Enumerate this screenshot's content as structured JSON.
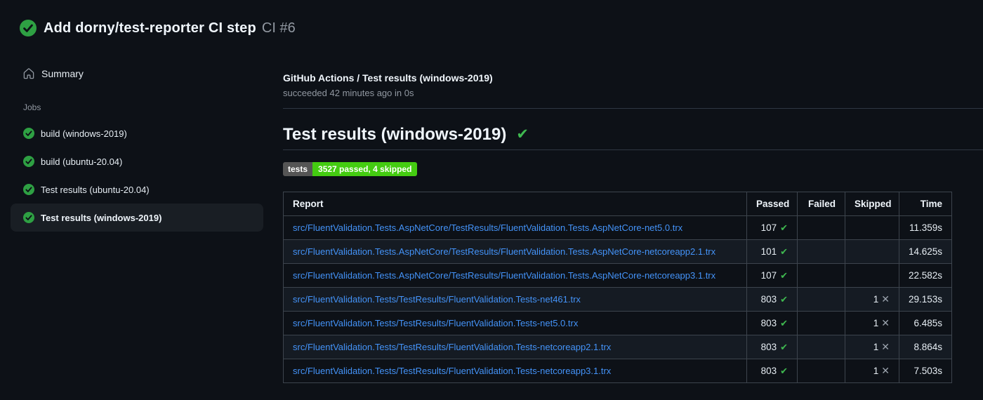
{
  "header": {
    "run_title": "Add dorny/test-reporter CI step",
    "run_number": "CI #6"
  },
  "sidebar": {
    "summary_label": "Summary",
    "jobs_label": "Jobs",
    "jobs": [
      {
        "label": "build (windows-2019)",
        "selected": false
      },
      {
        "label": "build (ubuntu-20.04)",
        "selected": false
      },
      {
        "label": "Test results (ubuntu-20.04)",
        "selected": false
      },
      {
        "label": "Test results (windows-2019)",
        "selected": true
      }
    ]
  },
  "main": {
    "check_title": "GitHub Actions / Test results (windows-2019)",
    "check_status": "succeeded 42 minutes ago in 0s",
    "section_title": "Test results (windows-2019)",
    "section_check_icon": "✔",
    "badge": {
      "label": "tests",
      "value": "3527 passed, 4 skipped",
      "label_bg": "#555555",
      "value_bg": "#44cc11"
    },
    "table": {
      "columns": [
        "Report",
        "Passed",
        "Failed",
        "Skipped",
        "Time"
      ],
      "rows": [
        {
          "report": "src/FluentValidation.Tests.AspNetCore/TestResults/FluentValidation.Tests.AspNetCore-net5.0.trx",
          "passed": "107",
          "failed": "",
          "skipped": "",
          "time": "11.359s"
        },
        {
          "report": "src/FluentValidation.Tests.AspNetCore/TestResults/FluentValidation.Tests.AspNetCore-netcoreapp2.1.trx",
          "passed": "101",
          "failed": "",
          "skipped": "",
          "time": "14.625s"
        },
        {
          "report": "src/FluentValidation.Tests.AspNetCore/TestResults/FluentValidation.Tests.AspNetCore-netcoreapp3.1.trx",
          "passed": "107",
          "failed": "",
          "skipped": "",
          "time": "22.582s"
        },
        {
          "report": "src/FluentValidation.Tests/TestResults/FluentValidation.Tests-net461.trx",
          "passed": "803",
          "failed": "",
          "skipped": "1",
          "time": "29.153s"
        },
        {
          "report": "src/FluentValidation.Tests/TestResults/FluentValidation.Tests-net5.0.trx",
          "passed": "803",
          "failed": "",
          "skipped": "1",
          "time": "6.485s"
        },
        {
          "report": "src/FluentValidation.Tests/TestResults/FluentValidation.Tests-netcoreapp2.1.trx",
          "passed": "803",
          "failed": "",
          "skipped": "1",
          "time": "8.864s"
        },
        {
          "report": "src/FluentValidation.Tests/TestResults/FluentValidation.Tests-netcoreapp3.1.trx",
          "passed": "803",
          "failed": "",
          "skipped": "1",
          "time": "7.503s"
        }
      ],
      "passed_icon": "✔",
      "skipped_icon": "✕"
    }
  },
  "colors": {
    "background": "#0d1117",
    "success_green": "#2ea043",
    "check_green": "#3fb950",
    "link_blue": "#4493f8",
    "muted_text": "#9198a1",
    "border": "#3d444d",
    "badge_green": "#44cc11",
    "badge_gray": "#555555"
  }
}
